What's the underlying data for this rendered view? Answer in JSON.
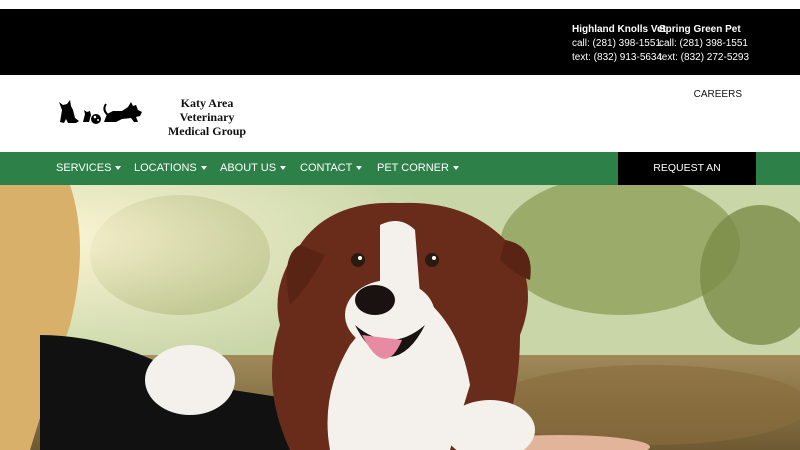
{
  "locations": [
    {
      "name": "Highland Knolls Vet",
      "call": "call: (281) 398-1551",
      "text": "text: (832) 913-5634"
    },
    {
      "name": "Spring Green Pet",
      "call": "call: (281) 398-1551",
      "text": "text: (832) 272-5293"
    }
  ],
  "logo": {
    "line1": "Katy Area Veterinary",
    "line2": "Medical Group"
  },
  "careers": "CAREERS",
  "nav": [
    "SERVICES",
    "LOCATIONS",
    "ABOUT US",
    "CONTACT",
    "PET CORNER"
  ],
  "cta": "REQUEST AN APPOINTMENT",
  "colors": {
    "nav_bg": "#2e8049",
    "topbar_bg": "#000000",
    "cta_bg": "#000000"
  },
  "icons": [
    "pet-silhouette-logo-icon",
    "chevron-down-icon"
  ]
}
